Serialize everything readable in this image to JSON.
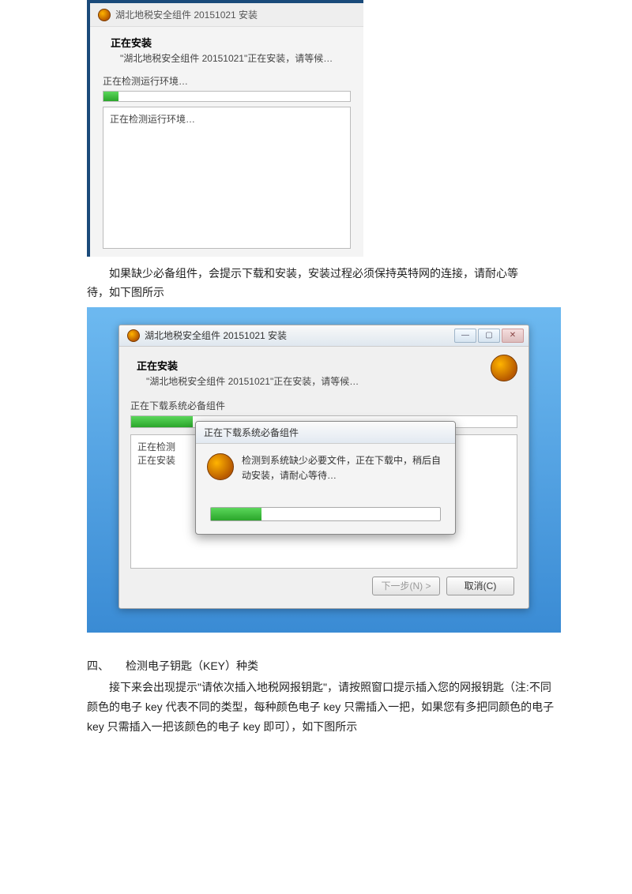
{
  "shot1": {
    "title": "湖北地税安全组件 20151021 安装",
    "heading": "正在安装",
    "subtitle": "\"湖北地税安全组件 20151021\"正在安装，请等候…",
    "status": "正在检测运行环境…",
    "log": "正在检测运行环境…"
  },
  "para1_line1": "如果缺少必备组件，会提示下载和安装，安装过程必须保持英特网的连接，请耐心等",
  "para1_line2": "待，如下图所示",
  "shot2": {
    "title": "湖北地税安全组件 20151021 安装",
    "heading": "正在安装",
    "subtitle": "\"湖北地税安全组件 20151021\"正在安装，请等候…",
    "status": "正在下载系统必备组件",
    "log1": "正在检测",
    "log2": "正在安装",
    "btn_next": "下一步(N) >",
    "btn_cancel": "取消(C)",
    "popup_title": "正在下载系统必备组件",
    "popup_text": "检测到系统缺少必要文件，正在下载中，稍后自动安装，请耐心等待…"
  },
  "sec4": {
    "heading": "四、　　检测电子钥匙（KEY）种类",
    "body": "接下来会出现提示\"请依次插入地税网报钥匙\"，请按照窗口提示插入您的网报钥匙（注:不同颜色的电子 key 代表不同的类型，每种颜色电子 key 只需插入一把，如果您有多把同颜色的电子 key 只需插入一把该颜色的电子 key 即可），如下图所示"
  }
}
